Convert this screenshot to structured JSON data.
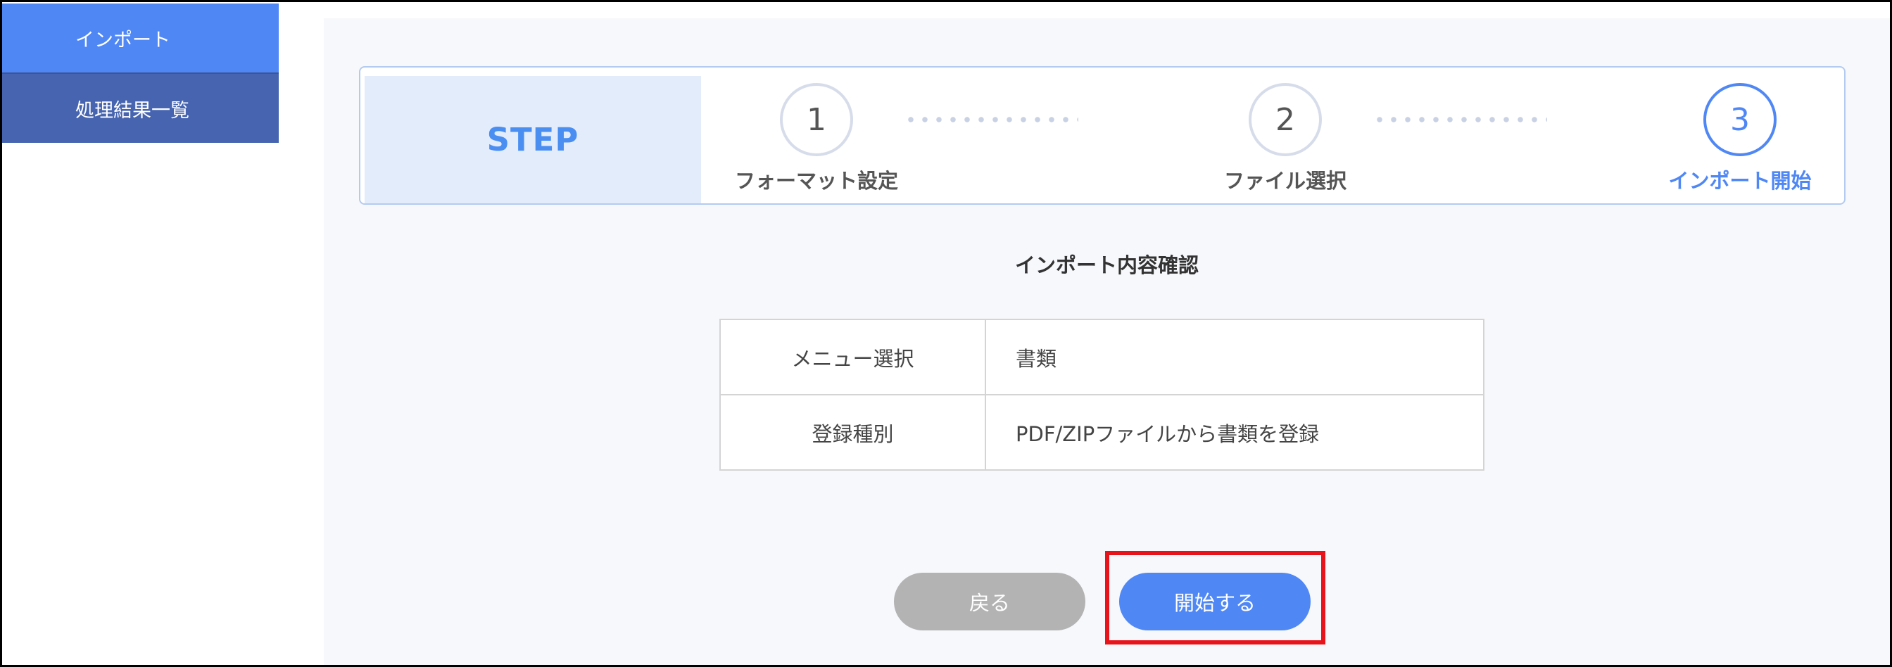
{
  "sidebar": {
    "items": [
      {
        "label": "インポート",
        "active": true
      },
      {
        "label": "処理結果一覧",
        "active": false
      }
    ]
  },
  "stepper": {
    "label": "STEP",
    "steps": [
      {
        "number": "1",
        "name": "フォーマット設定"
      },
      {
        "number": "2",
        "name": "ファイル選択"
      },
      {
        "number": "3",
        "name": "インポート開始",
        "current": true
      }
    ]
  },
  "confirm": {
    "title": "インポート内容確認",
    "rows": [
      {
        "key": "メニュー選択",
        "value": "書類"
      },
      {
        "key": "登録種別",
        "value": "PDF/ZIPファイルから書類を登録"
      }
    ]
  },
  "buttons": {
    "back_label": "戻る",
    "start_label": "開始する"
  },
  "colors": {
    "accent": "#4f87f5",
    "sidebar_secondary": "#4664b0",
    "highlight": "#e8141b",
    "disabled_button": "#b3b3b3"
  }
}
